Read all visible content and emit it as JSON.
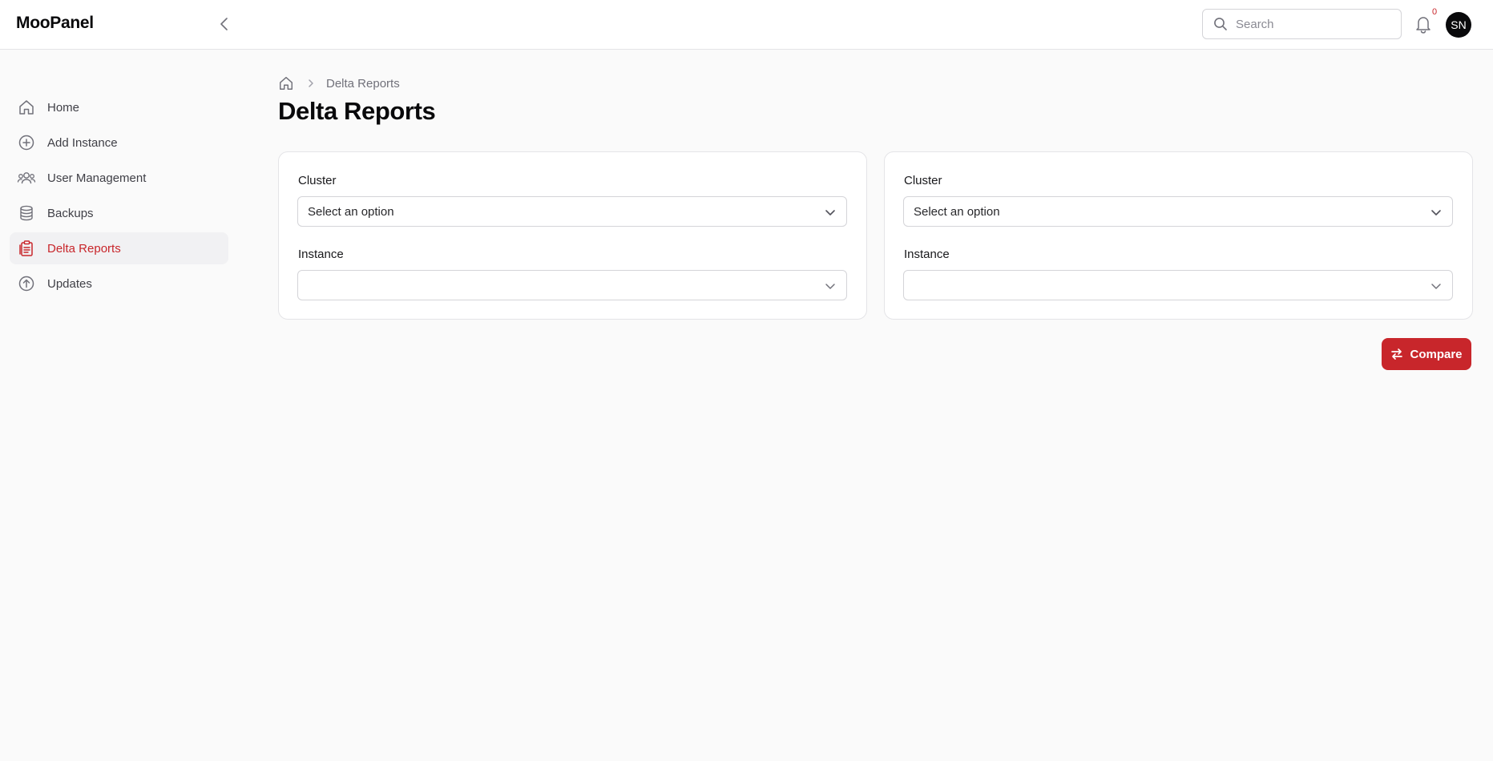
{
  "app": {
    "brand": "MooPanel"
  },
  "header": {
    "search_placeholder": "Search",
    "notification_count": "0",
    "avatar_initials": "SN"
  },
  "sidebar": {
    "items": [
      {
        "label": "Home",
        "icon": "home-icon",
        "active": false
      },
      {
        "label": "Add Instance",
        "icon": "plus-circle-icon",
        "active": false
      },
      {
        "label": "User Management",
        "icon": "users-icon",
        "active": false
      },
      {
        "label": "Backups",
        "icon": "database-icon",
        "active": false
      },
      {
        "label": "Delta Reports",
        "icon": "clipboard-report-icon",
        "active": true
      },
      {
        "label": "Updates",
        "icon": "arrow-up-circle-icon",
        "active": false
      }
    ]
  },
  "breadcrumb": {
    "current": "Delta Reports"
  },
  "page": {
    "title": "Delta Reports"
  },
  "panels": [
    {
      "cluster_label": "Cluster",
      "cluster_value": "Select an option",
      "instance_label": "Instance",
      "instance_value": ""
    },
    {
      "cluster_label": "Cluster",
      "cluster_value": "Select an option",
      "instance_label": "Instance",
      "instance_value": ""
    }
  ],
  "actions": {
    "compare_label": "Compare"
  },
  "colors": {
    "accent": "#c8262b",
    "border": "#e4e4e7",
    "background": "#fafafa"
  }
}
